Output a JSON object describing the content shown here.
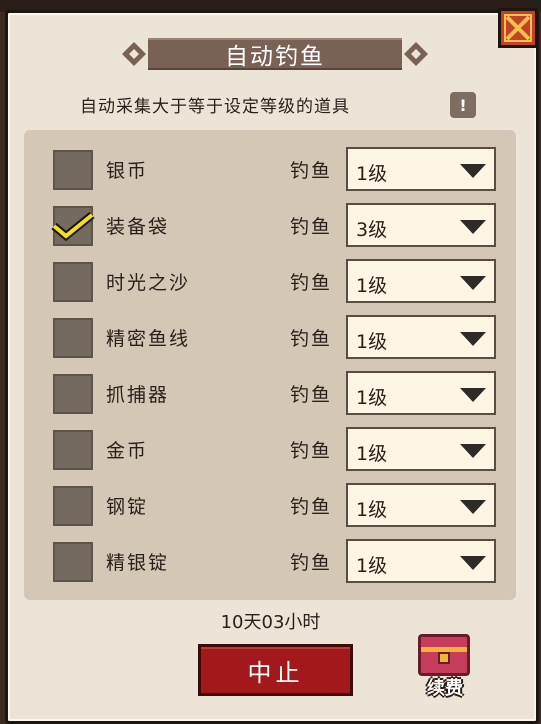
{
  "title": "自动钓鱼",
  "subtitle": "自动采集大于等于设定等级的道具",
  "hint_icon": "!",
  "items": [
    {
      "name": "银币",
      "category": "钓鱼",
      "level": "1级",
      "checked": false
    },
    {
      "name": "装备袋",
      "category": "钓鱼",
      "level": "3级",
      "checked": true
    },
    {
      "name": "时光之沙",
      "category": "钓鱼",
      "level": "1级",
      "checked": false
    },
    {
      "name": "精密鱼线",
      "category": "钓鱼",
      "level": "1级",
      "checked": false
    },
    {
      "name": "抓捕器",
      "category": "钓鱼",
      "level": "1级",
      "checked": false
    },
    {
      "name": "金币",
      "category": "钓鱼",
      "level": "1级",
      "checked": false
    },
    {
      "name": "钢锭",
      "category": "钓鱼",
      "level": "1级",
      "checked": false
    },
    {
      "name": "精银锭",
      "category": "钓鱼",
      "level": "1级",
      "checked": false
    }
  ],
  "timer": "10天03小时",
  "stop_label": "中止",
  "renew_label": "续费",
  "colors": {
    "stop": "#a3181a",
    "check": "#f2e21c",
    "close": "#c2412c"
  }
}
